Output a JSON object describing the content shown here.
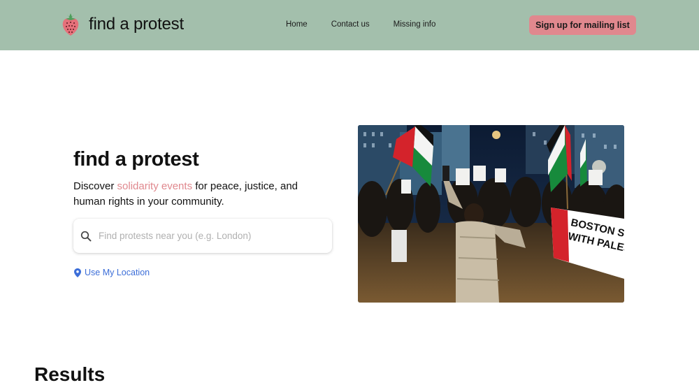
{
  "header": {
    "brand": "find a protest",
    "nav": [
      "Home",
      "Contact us",
      "Missing info"
    ],
    "cta_label": "Sign up for mailing list",
    "background_color": "#a3bfac",
    "cta_color": "#e0888e",
    "logo_icon": "strawberry-icon"
  },
  "hero": {
    "title": "find a protest",
    "desc_before": "Discover ",
    "desc_highlight": "solidarity events",
    "desc_after": " for peace, justice, and human rights in your community.",
    "accent_color": "#e0888e",
    "search_placeholder": "Find protests near you (e.g. London)",
    "search_value": "",
    "search_icon": "search-icon",
    "location_label": "Use My Location",
    "location_icon": "map-pin-icon",
    "photo_banner_text": [
      "BOSTON ST",
      "WITH PALES"
    ]
  },
  "results": {
    "title": "Results"
  }
}
